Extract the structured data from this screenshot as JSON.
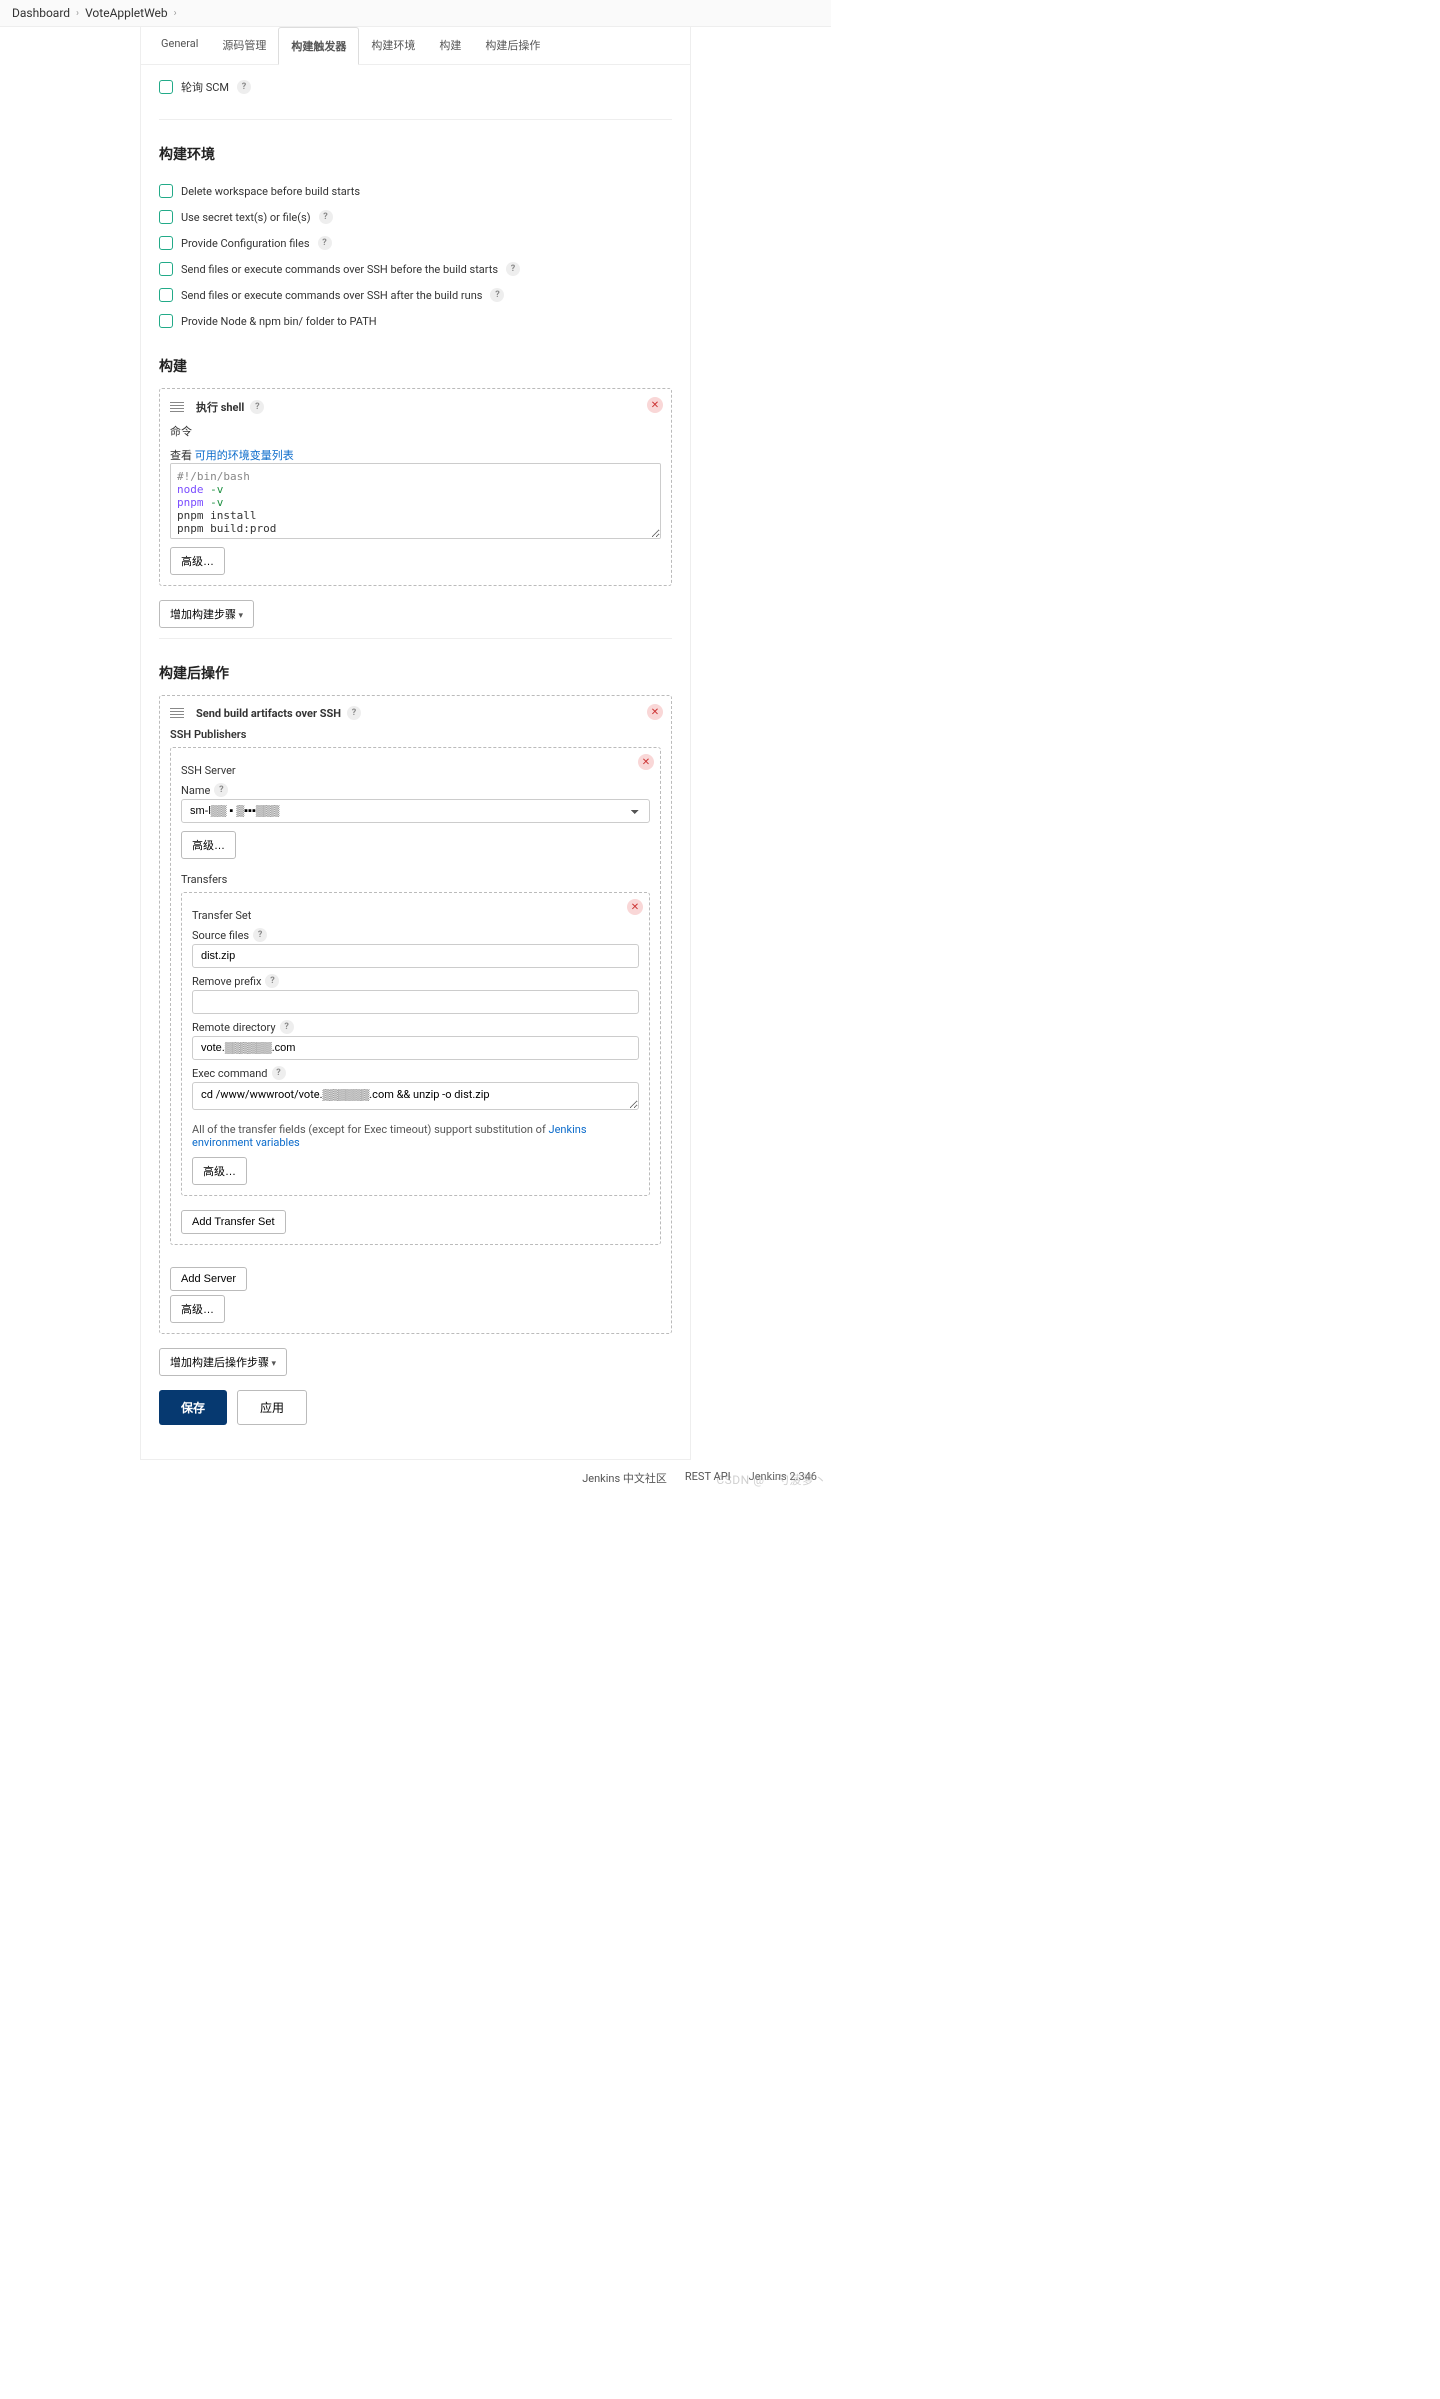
{
  "breadcrumb": {
    "dashboard": "Dashboard",
    "project": "VoteAppletWeb"
  },
  "tabs": {
    "general": "General",
    "scm": "源码管理",
    "triggers": "构建触发器",
    "env": "构建环境",
    "build": "构建",
    "post": "构建后操作"
  },
  "triggers": {
    "poll_scm": "轮询 SCM"
  },
  "env": {
    "title": "构建环境",
    "delete_workspace": "Delete workspace before build starts",
    "secret_text": "Use secret text(s) or file(s)",
    "config_files": "Provide Configuration files",
    "ssh_before": "Send files or execute commands over SSH before the build starts",
    "ssh_after": "Send files or execute commands over SSH after the build runs",
    "node_npm": "Provide Node & npm bin/ folder to PATH"
  },
  "build": {
    "title": "构建",
    "shell_step_title": "执行 shell",
    "command_label": "命令",
    "see_label": "查看",
    "env_vars_link": "可用的环境变量列表",
    "script_line1": "#!/bin/bash",
    "script_line2_cmd": "node",
    "script_line2_flag": "-v",
    "script_line3_cmd": "pnpm",
    "script_line3_flag": "-v",
    "script_line4": "pnpm install",
    "script_line5": "pnpm build:prod",
    "advanced": "高级…",
    "add_step": "增加构建步骤"
  },
  "post": {
    "title": "构建后操作",
    "step_title": "Send build artifacts over SSH",
    "ssh_publishers": "SSH Publishers",
    "ssh_server": "SSH Server",
    "name_label": "Name",
    "server_value": "sm-l▒▒ ▪ ▒▪▪▪▒▒▒",
    "advanced": "高级…",
    "transfers": "Transfers",
    "transfer_set": "Transfer Set",
    "source_files": "Source files",
    "source_files_value": "dist.zip",
    "remove_prefix": "Remove prefix",
    "remove_prefix_value": "",
    "remote_directory": "Remote directory",
    "remote_directory_value": "vote.▒▒▒▒▒▒.com",
    "exec_command": "Exec command",
    "exec_command_value": "cd /www/wwwroot/vote.▒▒▒▒▒▒.com && unzip -o dist.zip",
    "note_prefix": "All of the transfer fields (except for Exec timeout) support substitution of ",
    "note_link": "Jenkins environment variables",
    "add_transfer_set": "Add Transfer Set",
    "add_server": "Add Server",
    "add_post_step": "增加构建后操作步骤"
  },
  "actions": {
    "save": "保存",
    "apply": "应用"
  },
  "footer": {
    "community": "Jenkins 中文社区",
    "rest_api": "REST API",
    "version": "Jenkins 2.346"
  },
  "watermark": "CSDN @一勺菠萝丶"
}
